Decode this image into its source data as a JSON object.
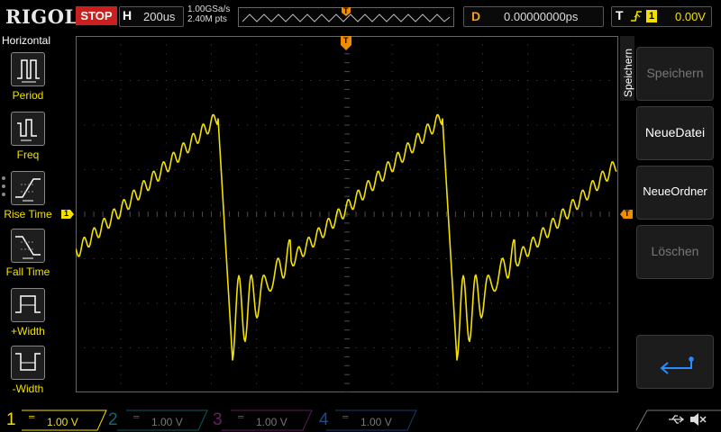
{
  "top": {
    "logo": "RIGOL",
    "run_status": "STOP",
    "horizontal_letter": "H",
    "timebase": "200us",
    "sample_rate": "1.00GSa/s",
    "memory_points": "2.40M pts",
    "trigger_marker": "T",
    "delay_letter": "D",
    "delay_value": "0.00000000ps",
    "trigger_letter": "T",
    "trigger_channel": "1",
    "trigger_level": "0.00V"
  },
  "left_menu": {
    "title": "Horizontal",
    "items": [
      {
        "label": "Period",
        "icon": "period-icon"
      },
      {
        "label": "Freq",
        "icon": "freq-icon"
      },
      {
        "label": "Rise Time",
        "icon": "rise-time-icon"
      },
      {
        "label": "Fall Time",
        "icon": "fall-time-icon"
      },
      {
        "label": "+Width",
        "icon": "pos-width-icon"
      },
      {
        "label": "-Width",
        "icon": "neg-width-icon"
      }
    ]
  },
  "right_menu": {
    "tab_label": "Speichern",
    "buttons": [
      {
        "label": "Speichern",
        "enabled": false
      },
      {
        "label": "NeueDatei",
        "enabled": true
      },
      {
        "label": "NeueOrdner",
        "enabled": true
      },
      {
        "label": "Löschen",
        "enabled": false
      }
    ],
    "back_icon": "return-arrow-icon"
  },
  "markers": {
    "ch1_ground": "1",
    "trigger_time": "T",
    "trigger_level": "T"
  },
  "channels": [
    {
      "number": "1",
      "scale": "1.00 V",
      "color": "#f2e100",
      "active": true
    },
    {
      "number": "2",
      "scale": "1.00 V",
      "color": "#00c8c8",
      "active": false
    },
    {
      "number": "3",
      "scale": "1.00 V",
      "color": "#d030d0",
      "active": false
    },
    {
      "number": "4",
      "scale": "1.00 V",
      "color": "#2a7cf0",
      "active": false
    }
  ],
  "status_icons": [
    "usb-icon",
    "speaker-muted-icon"
  ],
  "colors": {
    "waveform": "#f2e100",
    "grid": "#4a4a4a",
    "trigger": "#f08c00",
    "stop": "#c8201e"
  }
}
